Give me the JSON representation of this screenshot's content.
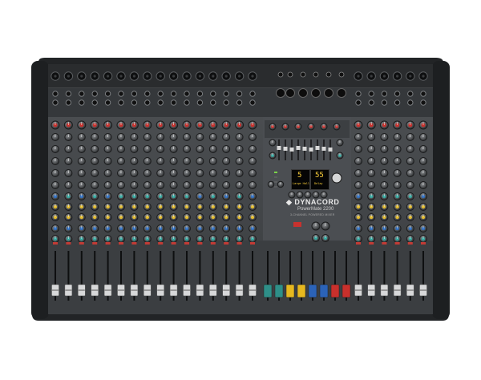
{
  "brand": {
    "name": "DYNACORD",
    "model": "PowerMate 2200",
    "tagline": "3-CHANNEL POWERED MIXER"
  },
  "displays": {
    "left": {
      "value": "5",
      "label": "Large Hall 1"
    },
    "right": {
      "value": "55",
      "label": "Delay"
    }
  },
  "colors": {
    "body": "#2e3033",
    "panel": "#3f4245",
    "knob_red": "#c8322e",
    "knob_yellow": "#e1b92a",
    "knob_blue": "#2f6fc1",
    "knob_teal": "#34a8a0",
    "fader_red": "#c9302c",
    "fader_yellow": "#e6b81f",
    "fader_blue": "#2b63b8",
    "fader_teal": "#2e8f88",
    "display_text": "#ffd23a"
  },
  "controls": {
    "input_channels": 22,
    "eq_bands": 9
  }
}
